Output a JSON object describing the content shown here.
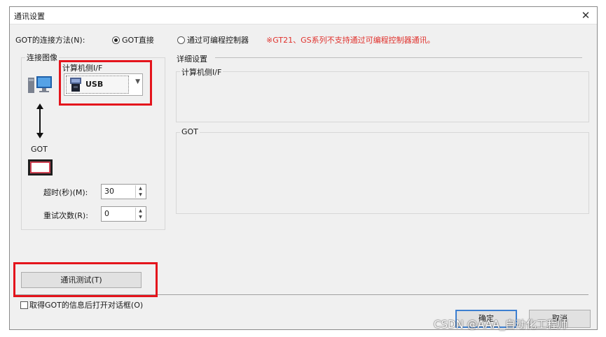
{
  "window": {
    "title": "通讯设置"
  },
  "connection": {
    "label": "GOT的连接方法(N):",
    "option_direct": "GOT直接",
    "option_plc": "通过可编程控制器",
    "warning": "※GT21、GS系列不支持通过可编程控制器通讯。",
    "selected": "GOT直接"
  },
  "image_group": {
    "label": "连接图像",
    "pc_if_label": "计算机侧I/F",
    "pc_if_value": "USB",
    "got_label": "GOT"
  },
  "timeout": {
    "label": "超时(秒)(M):",
    "value": "30"
  },
  "retry": {
    "label": "重试次数(R):",
    "value": "0"
  },
  "details": {
    "label": "详细设置",
    "pc_if_label": "计算机侧I/F",
    "got_label": "GOT"
  },
  "buttons": {
    "test": "通讯测试(T)",
    "ok": "确定",
    "cancel": "取消"
  },
  "checkbox": {
    "label": "取得GOT的信息后打开对话框(O)",
    "checked": false
  },
  "watermark": "CSDN @AAA_自动化工程师",
  "colors": {
    "highlight": "#e4141c",
    "warning": "#e0302b",
    "default_button": "#3c7fd1"
  }
}
